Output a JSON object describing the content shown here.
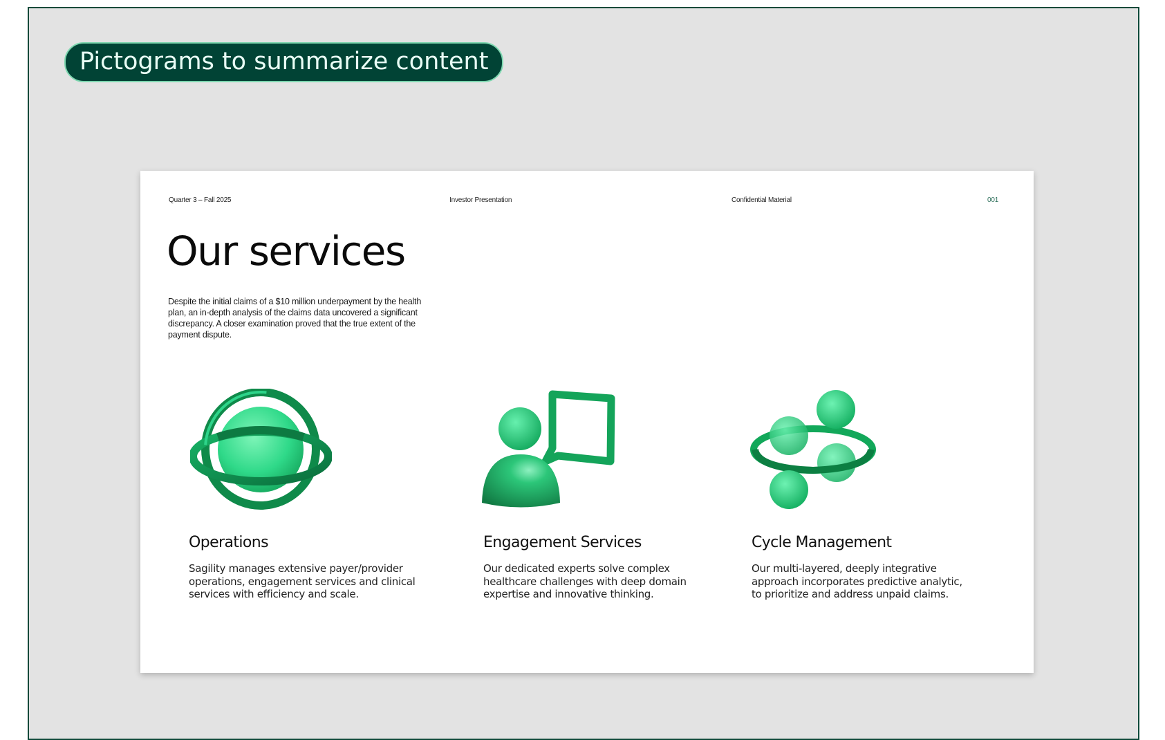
{
  "banner": {
    "label": "Pictograms to summarize content"
  },
  "slide": {
    "header": {
      "period": "Quarter 3 – Fall 2025",
      "doc_type": "Investor Presentation",
      "classification": "Confidential Material",
      "page_number": "001"
    },
    "title": "Our services",
    "intro": "Despite the initial claims of a $10 million underpayment by the health plan, an in-depth analysis of the claims data uncovered a significant discrepancy. A closer examination proved that the true extent of the payment dispute.",
    "services": [
      {
        "icon": "globe-orbit-icon",
        "title": "Operations",
        "description": "Sagility manages extensive payer/provider operations, engagement services and clinical services with efficiency and scale."
      },
      {
        "icon": "person-speech-bubble-icon",
        "title": "Engagement Services",
        "description": "Our dedicated experts solve complex healthcare challenges with deep domain expertise and innovative thinking."
      },
      {
        "icon": "spheres-ring-cycle-icon",
        "title": "Cycle Management",
        "description": "Our multi-layered, deeply integrative approach incorporates predictive analytic, to prioritize and address unpaid claims."
      }
    ],
    "colors": {
      "accent_dark": "#014335",
      "accent_green": "#1fd07f",
      "frame_border": "#0f4a3a"
    }
  }
}
